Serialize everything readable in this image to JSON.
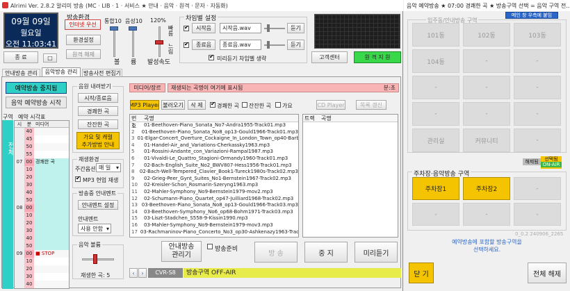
{
  "window": {
    "title": "Alrimi Ver. 2.8.2   알리미 방송  (MC · LIB · 1 · 서비스 ★ 안내 · 음악 · 원격 · 문자 · 자동화)"
  },
  "clock": {
    "date": "09월 09일",
    "weekday": "월요일",
    "time": "오전 11:03:41"
  },
  "top_buttons": {
    "end": "종  료",
    "small": "□"
  },
  "broadcast_env": {
    "title": "방송환경",
    "internet_priority": "인터넷 우선",
    "env_settings": "환경설정",
    "remote_release": "원격 해제",
    "bell_label": "통합10",
    "volume_label": "음성10",
    "pct": "120%",
    "speed_fast": "빠름",
    "speed_slow": "느림",
    "bell_axis": "볼",
    "vol_axis": "륨",
    "speed_axis": "발성속도"
  },
  "chime": {
    "title": "차임별 설정",
    "start_label": "시작음",
    "start_file": "시작음.wav",
    "end_label": "종료음",
    "end_file": "종료음.wav",
    "listen": "듣기",
    "preview_chime": "미리듣기 차임벨 생략"
  },
  "support": {
    "customer": "고객센터",
    "remote": "원 격 지 원"
  },
  "tabs": [
    "안내방송 관리기",
    "음악방송 관리기",
    "방송사전 편집기"
  ],
  "reservation": {
    "stop_btn": "예약방송 중지됨",
    "start_btn": "음악 예약방송 시작",
    "header_zone": "구역",
    "header_time": "예약 시각표",
    "col_min": "시",
    "col_sec": "분",
    "col_media": "미디어",
    "side_label": "전체",
    "rows": [
      {
        "h": "",
        "m": "40",
        "media": ""
      },
      {
        "h": "",
        "m": "45",
        "media": ""
      },
      {
        "h": "",
        "m": "50",
        "media": ""
      },
      {
        "h": "",
        "m": "55",
        "media": ""
      },
      {
        "h": "07",
        "m": "00",
        "media": "경쾌한 곡"
      },
      {
        "h": "",
        "m": "10",
        "media": ""
      },
      {
        "h": "",
        "m": "20",
        "media": ""
      },
      {
        "h": "",
        "m": "30",
        "media": ""
      },
      {
        "h": "",
        "m": "40",
        "media": ""
      },
      {
        "h": "",
        "m": "50",
        "media": ""
      },
      {
        "h": "08",
        "m": "00",
        "media": ""
      },
      {
        "h": "",
        "m": "10",
        "media": ""
      },
      {
        "h": "",
        "m": "20",
        "media": ""
      },
      {
        "h": "",
        "m": "30",
        "media": ""
      },
      {
        "h": "",
        "m": "40",
        "media": ""
      },
      {
        "h": "",
        "m": "50",
        "media": ""
      },
      {
        "h": "09",
        "m": "00",
        "media": "■ STOP"
      },
      {
        "h": "",
        "m": "10",
        "media": ""
      },
      {
        "h": "",
        "m": "20",
        "media": ""
      },
      {
        "h": "",
        "m": "30",
        "media": ""
      },
      {
        "h": "",
        "m": "40",
        "media": ""
      }
    ]
  },
  "music_import": {
    "title": "음원 내려받기",
    "btn1": "시작/종료음",
    "btn2": "경쾌한 곡",
    "btn3": "잔잔한 곡",
    "yellow1": "가요 및 캐럴",
    "yellow2": "추가방법 안내"
  },
  "play_env": {
    "title": "재생환경",
    "period_label": "주간옵션",
    "period_value": "매 일",
    "mp3": "MP3 현업 재생"
  },
  "announce": {
    "title": "방송중 안내멘트",
    "settings": "안내멘트 설정",
    "section": "안내멘트",
    "option": "사용 안함"
  },
  "volume": {
    "title": "음악 볼륨",
    "repeat_label": "재생한 곡: 5"
  },
  "media": {
    "tab_label": "미디어/장르",
    "now_playing": "재생되는 곡명이 여기에 표시됨",
    "minute_label": "분:초",
    "mp3_player": "MP3 Player",
    "load": "불러오기",
    "delete": "삭 제",
    "filter_lively": "경쾌한 곡",
    "filter_calm": "잔잔한 곡",
    "filter_kpop": "가요",
    "cd_player": "CD Player",
    "track_refresh": "목록 갱신",
    "col_no": "번호",
    "col_title": "곡명",
    "col_track": "트랙",
    "col_song": "곡명",
    "tracks": [
      "01-Beethoven-Piano_Sonata_No7-Andra1955-Track01.mp3",
      "01-Beethoven-Piano_Sonata_No8_op13-Gould1966-Track01.mp3",
      "01-Elgar-Concert_Overture_Cockaigne_In_London_Town_op40-Barb",
      "01-Handel-Air_and_Variations-Cherkassky1963.mp3",
      "01-Rossini-Andante_con_Variazioni-Rampal1987.mp3",
      "01-Vivaldi-Le_Quattro_Stagioni-Ormandy1960-Track01.mp3",
      "02-Bach-English_Suite_No2_BWV807-Hess1956-Track01.mp3",
      "02-Bach-Well-Tempered_Clavier_Book1-Tureck1980s-Track02.mp3",
      "02-Grieg-Peer_Gynt_Suites_No1-Bernstein1967-Track02.mp3",
      "02-Kreisler-Schon_Rosmarin-Szeryng1963.mp3",
      "02-Mahler-Symphony_No9-Bernstein1979-mov2.mp3",
      "02-Schumann-Piano_Quartet_op47-Juilliard1968-Track02.mp3",
      "03-Beethoven-Piano_Sonata_No8_op13-Gould1966-Track03.mp3",
      "03-Beethoven-Symphony_No6_op68-Bohm1971-Track03.mp3",
      "03-Liszt-Stadchen_S558-9-Kissin1990.mp3",
      "03-Mahler-Symphony_No9-Bernstein1979-mov3.mp3",
      "03-Rachmaninov-Piano_Concerto_No3_op30-Ashkenazy1963-Track03.mp3"
    ]
  },
  "bottom": {
    "announce_mgr_l1": "안내방송",
    "announce_mgr_l2": "관리기",
    "standby": "방송준비",
    "broadcast": "방  송",
    "stop": "중  지",
    "preview": "미리듣기",
    "status_code": "CVR-S8",
    "status_text": "방송구역 OFF-AIR"
  },
  "right_panel": {
    "title": "음악 예약방송 ★ 07:00  경쾌한 곡 ★ 방송구역 선택 = 음악 구역 전...",
    "dock_btn": "메인 창 우측에 붙임",
    "zone_title": "입주동/안내방송 구역",
    "zones": [
      "101동",
      "102동",
      "103동",
      "104동",
      "-",
      "-",
      "-",
      "-",
      "-",
      "-",
      "-",
      "-",
      "관리실",
      "커뮤니티",
      "-"
    ],
    "legend_off": "해제됨",
    "legend_on1": "선택됨",
    "legend_on2": "ON-AIR",
    "parking_title": "주차장·음악방송 구역",
    "parking": [
      "주차장1",
      "주차장2",
      "-",
      "-",
      "-",
      "-"
    ],
    "version": "0_0.2    240906_2265",
    "info": "예약방송에 포함할 방송구역을\n선택하세요.",
    "close": "닫 기",
    "clear_all": "전체 해제"
  },
  "colors": {
    "accent_teal": "#2ecfc4",
    "yellow": "#f5c400",
    "led_blue": "#0a2a5a",
    "status_bar": "#e8ec4a"
  }
}
